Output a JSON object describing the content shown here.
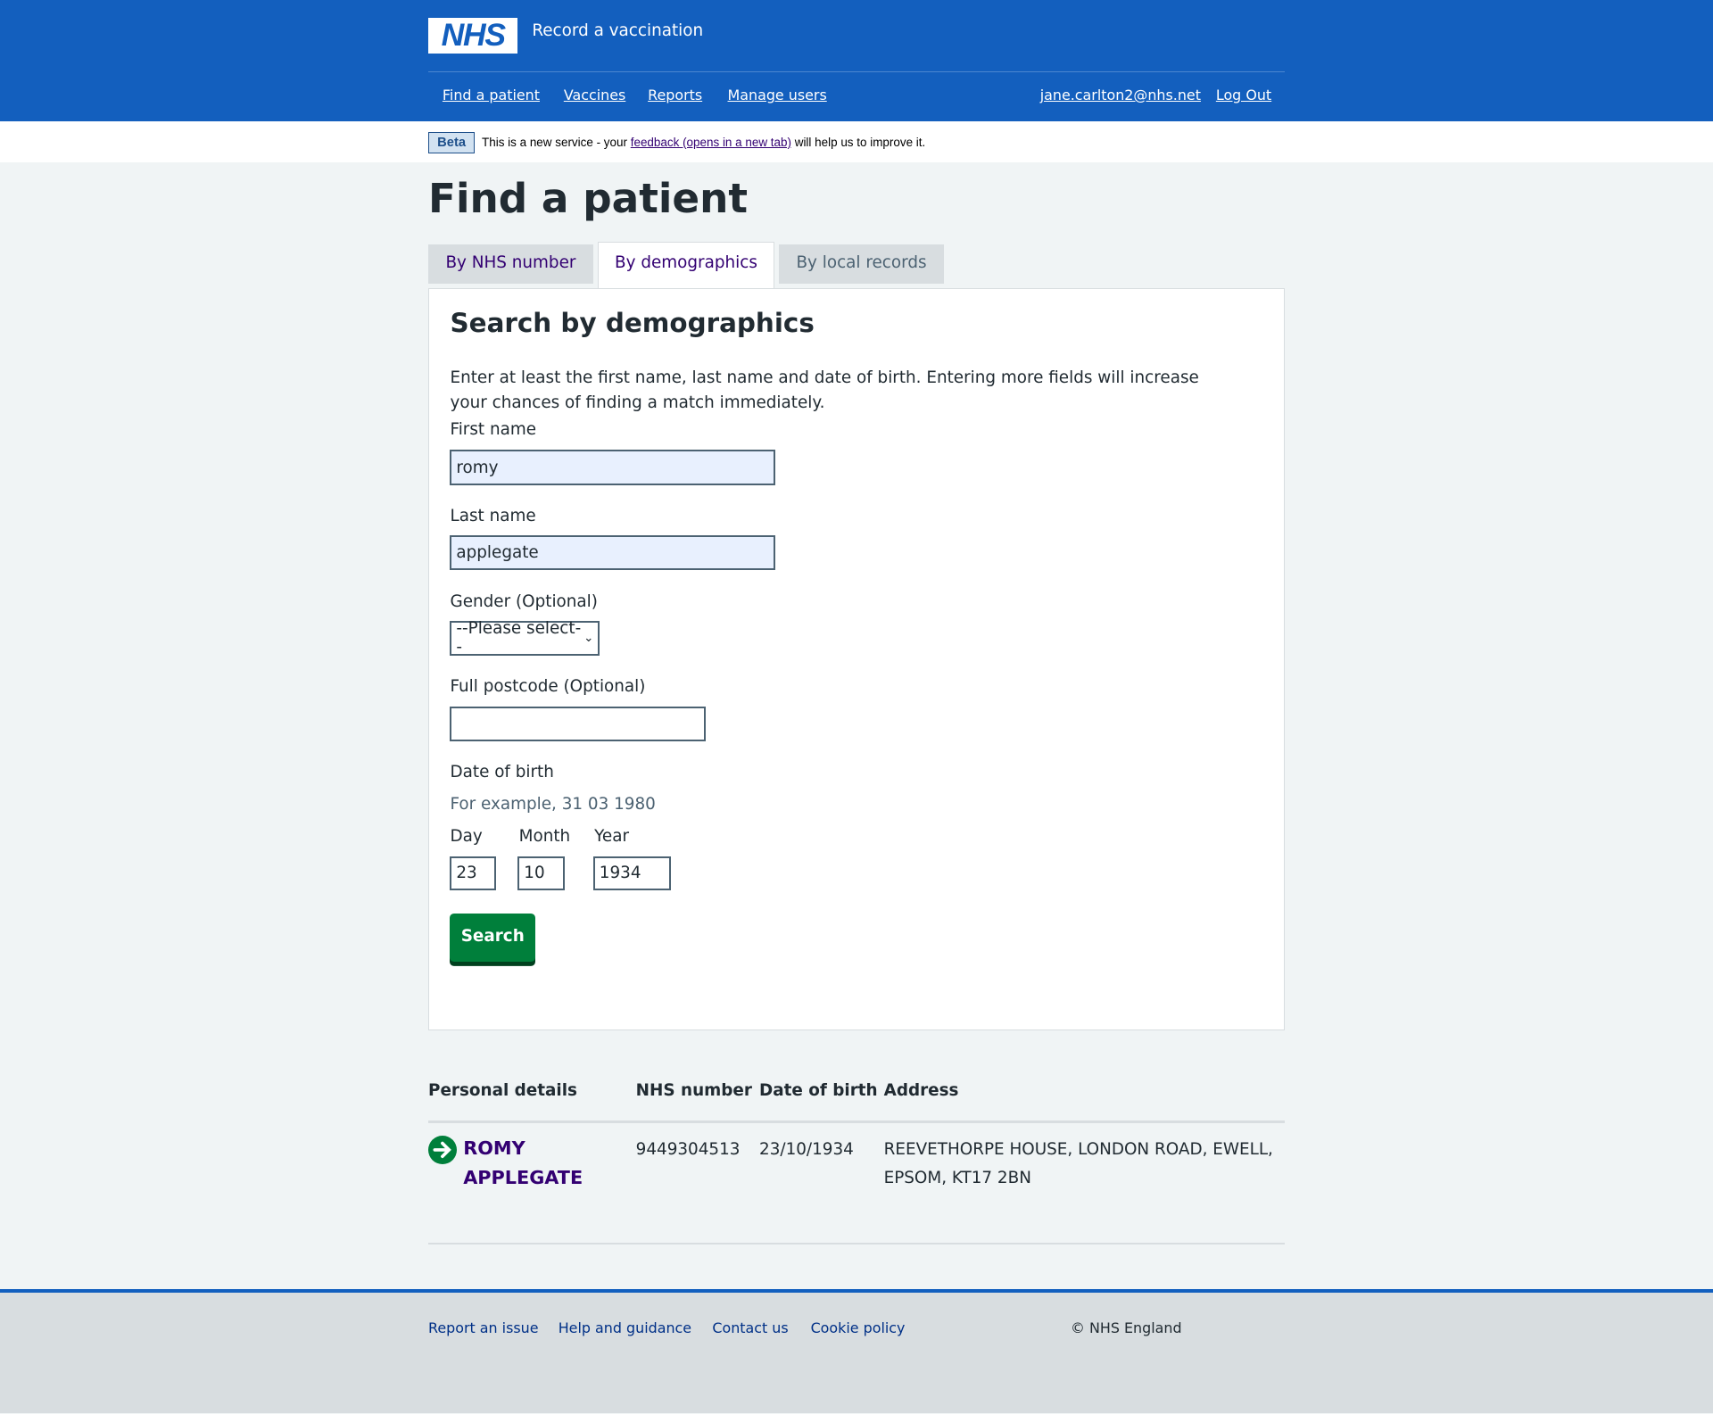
{
  "header": {
    "logo": "NHS",
    "service": "Record a vaccination",
    "nav": [
      "Find a patient",
      "Vaccines",
      "Reports",
      "Manage users"
    ],
    "user": "jane.carlton2@nhs.net",
    "logout": "Log Out",
    "color": "#135fbe"
  },
  "beta": {
    "tag": "Beta",
    "before": "This is a new service - your ",
    "link": "feedback (opens in a new tab)",
    "after": " will help us to improve it."
  },
  "page_title": "Find a patient",
  "tabs": [
    {
      "label": "By NHS number"
    },
    {
      "label": "By demographics",
      "active": true
    },
    {
      "label": "By local records"
    }
  ],
  "form": {
    "heading": "Search by demographics",
    "intro": "Enter at least the first name, last name and date of birth. Entering more fields will increase your chances of finding a match immediately.",
    "first_name": {
      "label": "First name",
      "value": "romy"
    },
    "last_name": {
      "label": "Last name",
      "value": "applegate"
    },
    "gender": {
      "label": "Gender (Optional)",
      "value": "--Please select--"
    },
    "postcode": {
      "label": "Full postcode (Optional)",
      "value": ""
    },
    "dob": {
      "label": "Date of birth",
      "hint": "For example, 31 03 1980",
      "day_label": "Day",
      "day": "23",
      "month_label": "Month",
      "month": "10",
      "year_label": "Year",
      "year": "1934"
    },
    "search_label": "Search"
  },
  "results": {
    "headers": [
      "Personal details",
      "NHS number",
      "Date of birth",
      "Address"
    ],
    "rows": [
      {
        "name": "ROMY APPLEGATE",
        "nhs": "9449304513",
        "dob": "23/10/1934",
        "address": "REEVETHORPE HOUSE, LONDON ROAD, EWELL, EPSOM, KT17 2BN"
      }
    ]
  },
  "footer": {
    "links": [
      "Report an issue",
      "Help and guidance",
      "Contact us",
      "Cookie policy"
    ],
    "copyright": "© NHS England"
  }
}
